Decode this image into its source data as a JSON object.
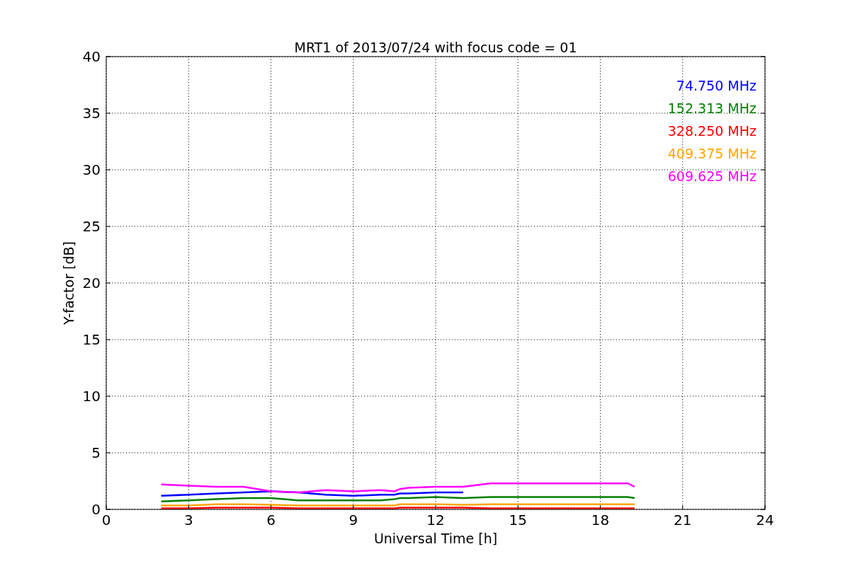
{
  "chart_data": {
    "type": "line",
    "title": "MRT1 of 2013/07/24 with focus code = 01",
    "xlabel": "Universal Time [h]",
    "ylabel": "Y-factor [dB]",
    "x": [
      2,
      3,
      4,
      5,
      6,
      7,
      8,
      9,
      10,
      10.5,
      10.7,
      11,
      12,
      13,
      14,
      19,
      19.25
    ],
    "series": [
      {
        "name": "74.750 MHz",
        "color": "#0000ff",
        "values": [
          1.2,
          1.3,
          1.4,
          1.5,
          1.6,
          1.5,
          1.3,
          1.2,
          1.3,
          1.3,
          1.4,
          1.4,
          1.5,
          1.5,
          null,
          null,
          null
        ]
      },
      {
        "name": "152.313 MHz",
        "color": "#008000",
        "values": [
          0.7,
          0.8,
          0.9,
          1.0,
          1.0,
          0.8,
          0.8,
          0.8,
          0.8,
          0.9,
          1.0,
          1.0,
          1.1,
          1.0,
          1.1,
          1.1,
          1.0
        ]
      },
      {
        "name": "328.250 MHz",
        "color": "#ff0000",
        "values": [
          0.1,
          0.1,
          0.15,
          0.15,
          0.15,
          0.1,
          0.1,
          0.1,
          0.1,
          0.1,
          0.15,
          0.15,
          0.15,
          0.15,
          0.1,
          0.1,
          0.1
        ]
      },
      {
        "name": "409.375 MHz",
        "color": "#ffa500",
        "values": [
          0.35,
          0.35,
          0.45,
          0.45,
          0.4,
          0.35,
          0.35,
          0.35,
          0.35,
          0.35,
          0.45,
          0.45,
          0.45,
          0.4,
          0.45,
          0.45,
          0.45
        ]
      },
      {
        "name": "609.625 MHz",
        "color": "#ff00ff",
        "values": [
          2.2,
          2.1,
          2.0,
          2.0,
          1.6,
          1.5,
          1.7,
          1.6,
          1.7,
          1.6,
          1.8,
          1.9,
          2.0,
          2.0,
          2.3,
          2.3,
          2.0
        ]
      }
    ],
    "xlim": [
      0,
      24
    ],
    "ylim": [
      0,
      40
    ],
    "xticks": [
      0,
      3,
      6,
      9,
      12,
      15,
      18,
      21,
      24
    ],
    "yticks": [
      0,
      5,
      10,
      15,
      20,
      25,
      30,
      35,
      40
    ],
    "grid": true
  }
}
